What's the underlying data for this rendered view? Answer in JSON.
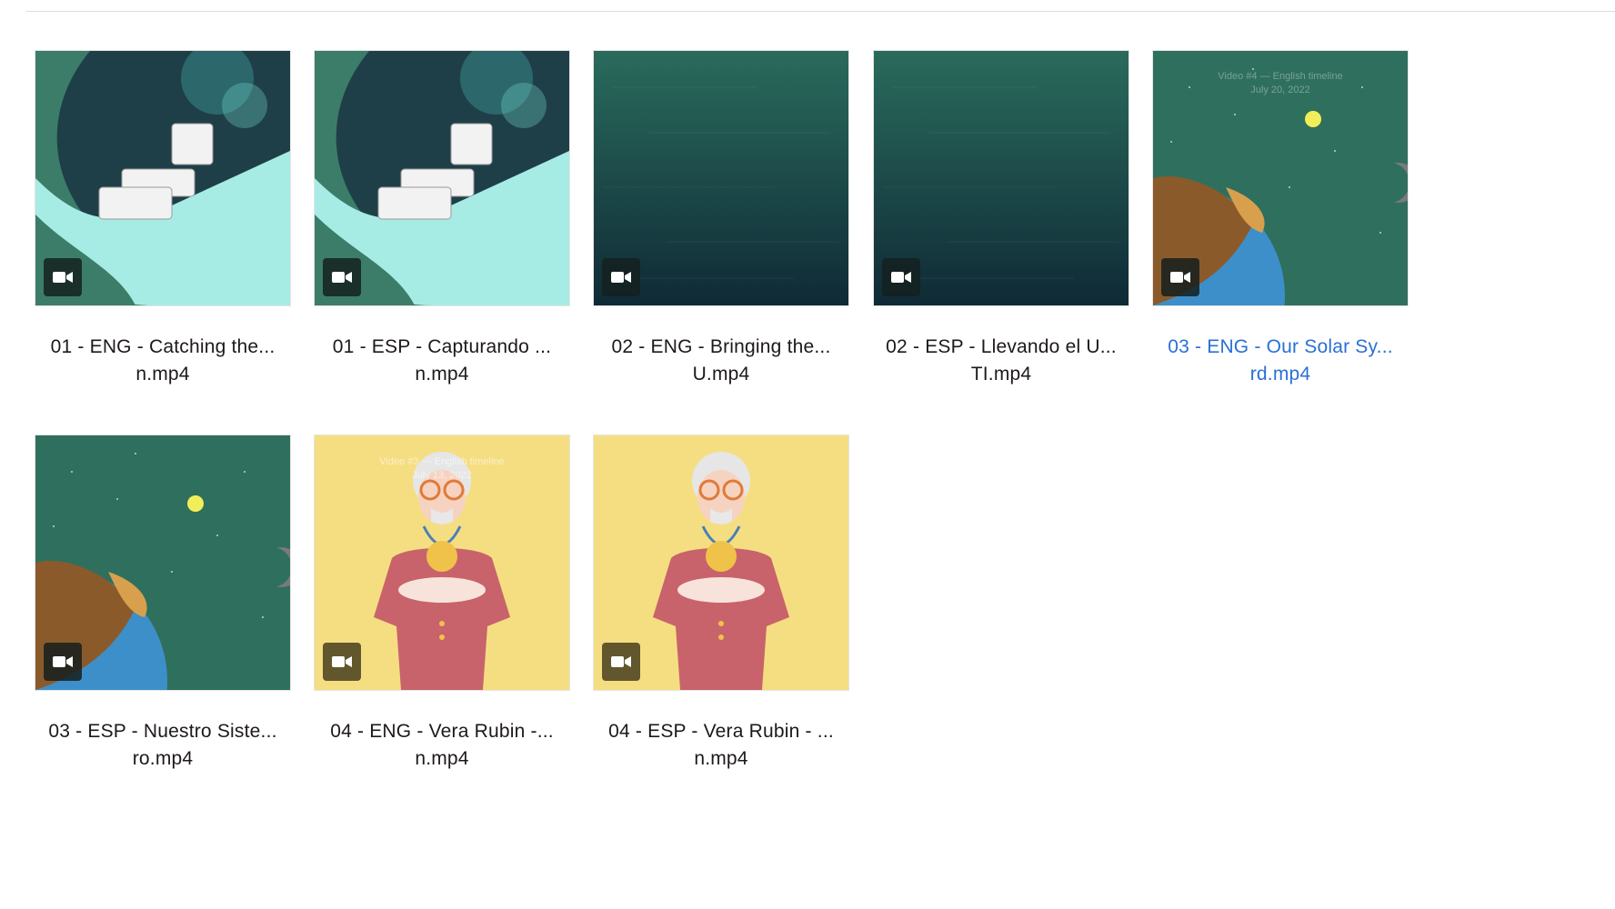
{
  "files": [
    {
      "line1": "01 - ENG - Catching the...",
      "line2": "n.mp4",
      "type": "video",
      "thumb": "telescope-curl",
      "selected": false
    },
    {
      "line1": "01 - ESP - Capturando ...",
      "line2": "n.mp4",
      "type": "video",
      "thumb": "telescope-curl",
      "selected": false
    },
    {
      "line1": "02 - ENG - Bringing the...",
      "line2": "U.mp4",
      "type": "video",
      "thumb": "dark-teal-streaks",
      "selected": false
    },
    {
      "line1": "02 - ESP - Llevando el U...",
      "line2": "TI.mp4",
      "type": "video",
      "thumb": "dark-teal-streaks",
      "selected": false
    },
    {
      "line1": "03 - ENG - Our Solar Sy...",
      "line2": "rd.mp4",
      "type": "video",
      "thumb": "earth-space",
      "selected": true,
      "overlay": [
        "Video #4 — English timeline",
        "July 20, 2022"
      ]
    },
    {
      "line1": "03 - ESP - Nuestro Siste...",
      "line2": "ro.mp4",
      "type": "video",
      "thumb": "earth-space",
      "selected": false
    },
    {
      "line1": "04 - ENG - Vera Rubin -...",
      "line2": "n.mp4",
      "type": "video",
      "thumb": "vera-rubin",
      "selected": false,
      "overlay": [
        "Video #3 — English timeline",
        "July 13, 2022"
      ]
    },
    {
      "line1": "04 - ESP - Vera Rubin - ...",
      "line2": "n.mp4",
      "type": "video",
      "thumb": "vera-rubin",
      "selected": false
    }
  ],
  "colors": {
    "link": "#2a6fd6",
    "text": "#1e1919"
  },
  "icons": {
    "badge": "video-camera-icon"
  }
}
